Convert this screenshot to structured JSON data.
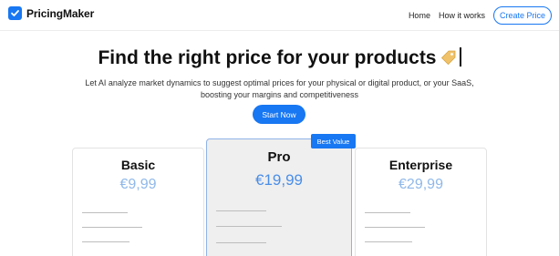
{
  "header": {
    "brand": "PricingMaker",
    "nav": [
      {
        "label": "Home"
      },
      {
        "label": "How it works"
      }
    ],
    "cta_label": "Create Price"
  },
  "hero": {
    "title": "Find the right price for your products",
    "subtitle_line1": "Let AI analyze market dynamics to suggest optimal prices for your physical or digital product, or your SaaS,",
    "subtitle_line2": "boosting your margins and competitiveness",
    "cta_label": "Start Now"
  },
  "plans": [
    {
      "name": "Basic",
      "price": "€9,99"
    },
    {
      "name": "Pro",
      "price": "€19,99",
      "badge": "Best Value"
    },
    {
      "name": "Enterprise",
      "price": "€29,99"
    }
  ],
  "colors": {
    "accent": "#1877f2",
    "price_muted": "#8fb8ea",
    "price_highlight": "#4a8ee8",
    "highlight_card_bg": "#efefef"
  }
}
